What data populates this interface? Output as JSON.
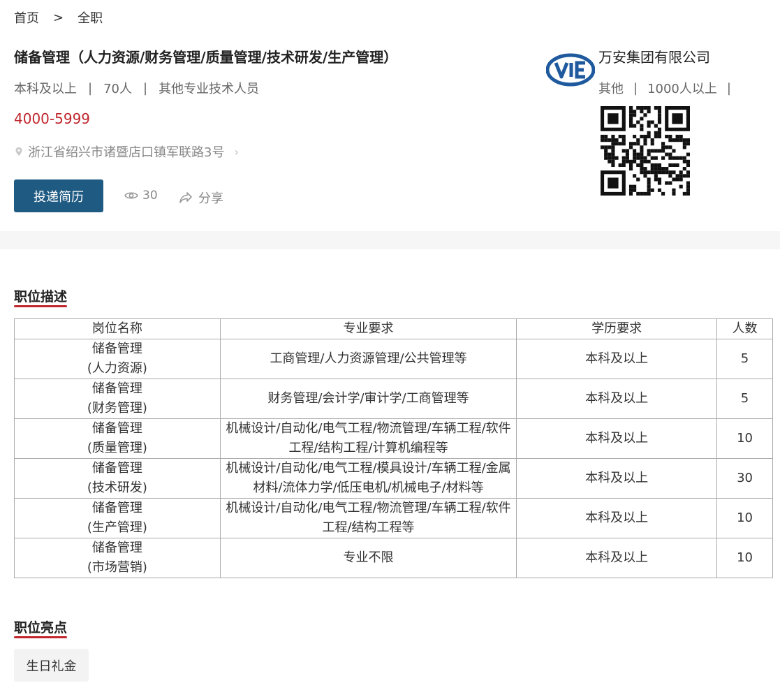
{
  "breadcrumb": {
    "home": "首页",
    "separator": ">",
    "current": "全职"
  },
  "job": {
    "title": "储备管理（人力资源/财务管理/质量管理/技术研发/生产管理）",
    "education": "本科及以上",
    "headcount": "70人",
    "category": "其他专业技术人员",
    "salary": "4000-5999",
    "address": "浙江省绍兴市诸暨店口镇军联路3号",
    "apply_label": "投递简历",
    "views": "30",
    "share_label": "分享"
  },
  "company": {
    "name": "万安集团有限公司",
    "industry": "其他",
    "size": "1000人以上",
    "logo_text": "VIE",
    "brand_color": "#1f5a9e"
  },
  "sections": {
    "description_title": "职位描述",
    "highlights_title": "职位亮点"
  },
  "table": {
    "headers": [
      "岗位名称",
      "专业要求",
      "学历要求",
      "人数"
    ],
    "rows": [
      {
        "name1": "储备管理",
        "name2": "(人力资源)",
        "major": "工商管理/人力资源管理/公共管理等",
        "edu": "本科及以上",
        "count": "5"
      },
      {
        "name1": "储备管理",
        "name2": "(财务管理)",
        "major": "财务管理/会计学/审计学/工商管理等",
        "edu": "本科及以上",
        "count": "5"
      },
      {
        "name1": "储备管理",
        "name2": "(质量管理)",
        "major": "机械设计/自动化/电气工程/物流管理/车辆工程/软件工程/结构工程/计算机编程等",
        "edu": "本科及以上",
        "count": "10"
      },
      {
        "name1": "储备管理",
        "name2": "(技术研发)",
        "major": "机械设计/自动化/电气工程/模具设计/车辆工程/金属材料/流体力学/低压电机/机械电子/材料等",
        "edu": "本科及以上",
        "count": "30"
      },
      {
        "name1": "储备管理",
        "name2": "(生产管理)",
        "major": "机械设计/自动化/电气工程/物流管理/车辆工程/软件工程/结构工程等",
        "edu": "本科及以上",
        "count": "10"
      },
      {
        "name1": "储备管理",
        "name2": "(市场营销)",
        "major": "专业不限",
        "edu": "本科及以上",
        "count": "10"
      }
    ]
  },
  "highlights": [
    "生日礼金"
  ],
  "colors": {
    "accent": "#1f5a82",
    "salary": "#c0272d"
  }
}
